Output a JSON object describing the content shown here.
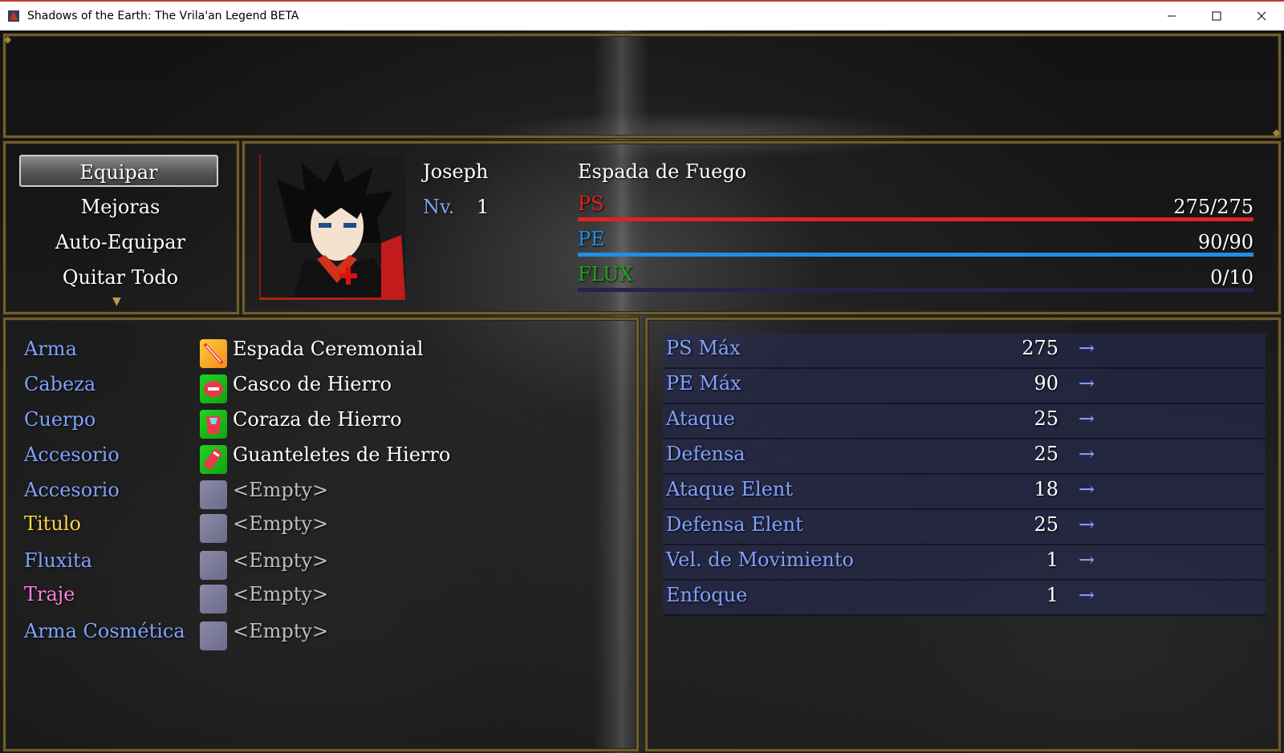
{
  "window": {
    "title": "Shadows of the Earth: The Vrila'an Legend BETA",
    "minimize_icon": "minimize-icon",
    "maximize_icon": "maximize-icon",
    "close_icon": "close-icon"
  },
  "menu": {
    "items": [
      {
        "label": "Equipar",
        "selected": true
      },
      {
        "label": "Mejoras",
        "selected": false
      },
      {
        "label": "Auto-Equipar",
        "selected": false
      },
      {
        "label": "Quitar Todo",
        "selected": false
      }
    ]
  },
  "actor": {
    "name": "Joseph",
    "level_label": "Nv.",
    "level": "1",
    "class": "Espada de Fuego",
    "hp": {
      "label": "PS",
      "value": "275/275",
      "fraction": 1.0,
      "color": "#e0221e"
    },
    "mp": {
      "label": "PE",
      "value": "90/90",
      "fraction": 1.0,
      "color": "#1f8fe6"
    },
    "flux": {
      "label": "FLUX",
      "value": "0/10",
      "fraction": 0.0,
      "color": "#1aa81a"
    }
  },
  "equipment": [
    {
      "slot": "Arma",
      "item": "Espada Ceremonial",
      "icon": "sword-icon",
      "slot_color": "#7fa3ff"
    },
    {
      "slot": "Cabeza",
      "item": "Casco de Hierro",
      "icon": "helmet-icon",
      "slot_color": "#7fa3ff"
    },
    {
      "slot": "Cuerpo",
      "item": "Coraza de Hierro",
      "icon": "armor-icon",
      "slot_color": "#7fa3ff"
    },
    {
      "slot": "Accesorio",
      "item": "Guanteletes de Hierro",
      "icon": "gauntlet-icon",
      "slot_color": "#7fa3ff"
    },
    {
      "slot": "Accesorio",
      "item": "<Empty>",
      "icon": "empty-slot-icon",
      "slot_color": "#7fa3ff"
    },
    {
      "slot": "Titulo",
      "item": "<Empty>",
      "icon": "empty-slot-icon",
      "slot_color": "#ffd54a"
    },
    {
      "slot": "Fluxita",
      "item": "<Empty>",
      "icon": "empty-slot-icon",
      "slot_color": "#7fa3ff"
    },
    {
      "slot": "Traje",
      "item": "<Empty>",
      "icon": "empty-slot-icon",
      "slot_color": "#ff80d8"
    },
    {
      "slot": "Arma Cosmética",
      "item": "<Empty>",
      "icon": "empty-slot-icon",
      "slot_color": "#7fa3ff"
    }
  ],
  "stats": [
    {
      "name": "PS Máx",
      "value": "275",
      "arrow": "→"
    },
    {
      "name": "PE Máx",
      "value": "90",
      "arrow": "→"
    },
    {
      "name": "Ataque",
      "value": "25",
      "arrow": "→"
    },
    {
      "name": "Defensa",
      "value": "25",
      "arrow": "→"
    },
    {
      "name": "Ataque Elent",
      "value": "18",
      "arrow": "→"
    },
    {
      "name": "Defensa Elent",
      "value": "25",
      "arrow": "→"
    },
    {
      "name": "Vel. de Movimiento",
      "value": "1",
      "arrow": "→"
    },
    {
      "name": "Enfoque",
      "value": "1",
      "arrow": "→"
    }
  ]
}
